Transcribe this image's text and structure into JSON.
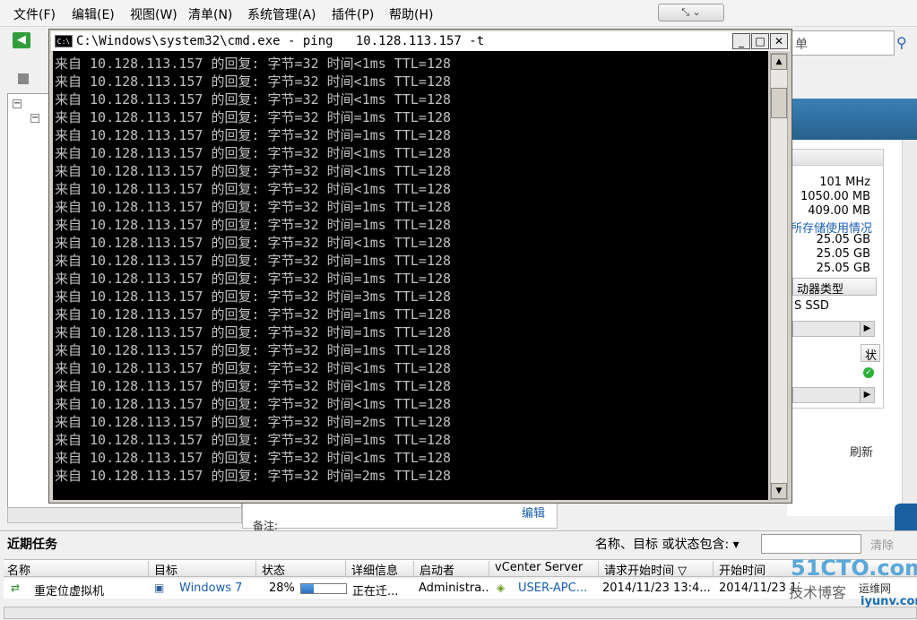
{
  "menu": {
    "items": [
      "文件(F)",
      "编辑(E)",
      "视图(W)",
      "清单(N)",
      "系统管理(A)",
      "插件(P)",
      "帮助(H)"
    ],
    "window_controls": "⤡ ⌄"
  },
  "toolbar": {
    "back_label": "◀",
    "search_value": "单"
  },
  "cmd": {
    "title": "C:\\Windows\\system32\\cmd.exe - ping   10.128.113.157 -t",
    "icon_label": "C:\\",
    "minimize": "_",
    "maximize": "□",
    "close": "✕",
    "lines": [
      "来自 10.128.113.157 的回复: 字节=32 时间<1ms TTL=128",
      "来自 10.128.113.157 的回复: 字节=32 时间<1ms TTL=128",
      "来自 10.128.113.157 的回复: 字节=32 时间<1ms TTL=128",
      "来自 10.128.113.157 的回复: 字节=32 时间=1ms TTL=128",
      "来自 10.128.113.157 的回复: 字节=32 时间=1ms TTL=128",
      "来自 10.128.113.157 的回复: 字节=32 时间<1ms TTL=128",
      "来自 10.128.113.157 的回复: 字节=32 时间<1ms TTL=128",
      "来自 10.128.113.157 的回复: 字节=32 时间<1ms TTL=128",
      "来自 10.128.113.157 的回复: 字节=32 时间=1ms TTL=128",
      "来自 10.128.113.157 的回复: 字节=32 时间=1ms TTL=128",
      "来自 10.128.113.157 的回复: 字节=32 时间<1ms TTL=128",
      "来自 10.128.113.157 的回复: 字节=32 时间=1ms TTL=128",
      "来自 10.128.113.157 的回复: 字节=32 时间=1ms TTL=128",
      "来自 10.128.113.157 的回复: 字节=32 时间=3ms TTL=128",
      "来自 10.128.113.157 的回复: 字节=32 时间=1ms TTL=128",
      "来自 10.128.113.157 的回复: 字节=32 时间=1ms TTL=128",
      "来自 10.128.113.157 的回复: 字节=32 时间=1ms TTL=128",
      "来自 10.128.113.157 的回复: 字节=32 时间<1ms TTL=128",
      "来自 10.128.113.157 的回复: 字节=32 时间<1ms TTL=128",
      "来自 10.128.113.157 的回复: 字节=32 时间<1ms TTL=128",
      "来自 10.128.113.157 的回复: 字节=32 时间=2ms TTL=128",
      "来自 10.128.113.157 的回复: 字节=32 时间=1ms TTL=128",
      "来自 10.128.113.157 的回复: 字节=32 时间<1ms TTL=128",
      "来自 10.128.113.157 的回复: 字节=32 时间=2ms TTL=128"
    ]
  },
  "summary": {
    "cpu": "101 MHz",
    "memory1": "1050.00 MB",
    "memory2": "409.00 MB",
    "storage_link": "所存储使用情况",
    "storage1": "25.05 GB",
    "storage2": "25.05 GB",
    "storage3": "25.05 GB",
    "drive_type_header": "动器类型",
    "drive_type": "S SSD",
    "status_header": "状",
    "refresh": "刷新",
    "edit_link": "编辑",
    "notes_label": "备注:"
  },
  "tasks": {
    "title": "近期任务",
    "filter_label": "名称、目标 或状态包含: ▾",
    "filter_value": "",
    "clear": "清除",
    "columns": [
      "名称",
      "目标",
      "状态",
      "详细信息",
      "启动者",
      "vCenter Server",
      "请求开始时间  ▽",
      "开始时间"
    ],
    "row": {
      "name": "重定位虚拟机",
      "target": "Windows 7",
      "status_percent": "28%",
      "progress": 0.28,
      "detail": "正在迁...",
      "initiator": "Administra...",
      "vcenter": "USER-APC...",
      "request_time": "2014/11/23 13:4...",
      "start_time": "2014/11/23 13:4..."
    }
  },
  "watermark": {
    "line1": "51CTO.com",
    "line2": "技术博客",
    "line3": "iyunv.com",
    "line4": "运维网"
  }
}
